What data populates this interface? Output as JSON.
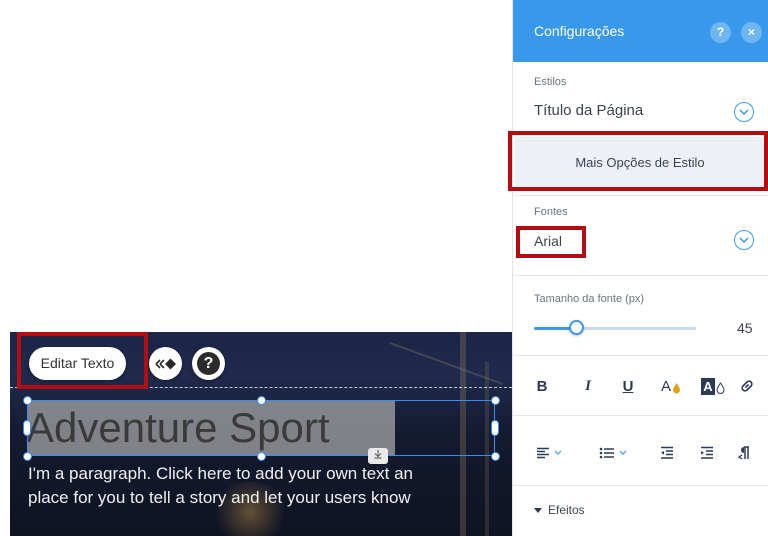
{
  "canvas": {
    "edit_button_label": "Editar Texto",
    "heading_text": "Adventure Sport",
    "paragraph_line1": "I'm a paragraph. Click here to add your own text an",
    "paragraph_line2": "place for you to tell a story and let your users know"
  },
  "panel": {
    "title": "Configurações",
    "help_label": "?",
    "close_label": "×",
    "styles_label": "Estilos",
    "styles_value": "Título da Página",
    "more_style_options": "Mais Opções de Estilo",
    "fonts_label": "Fontes",
    "font_value": "Arial",
    "font_size_label": "Tamanho da fonte (px)",
    "font_size_value": "45",
    "font_size_fraction": 0.26,
    "effects_label": "Efeitos"
  },
  "format_toolbar": {
    "bold": "B",
    "italic": "I",
    "underline": "U",
    "text_color_letter": "A",
    "highlight_letter": "A"
  },
  "icons": [
    "animation-icon",
    "help-icon",
    "chevron-down-icon",
    "link-icon",
    "align-left-icon",
    "bullet-list-icon",
    "decrease-indent-icon",
    "increase-indent-icon",
    "text-direction-icon"
  ],
  "colors": {
    "accent": "#3899ec",
    "highlight_frame": "#b40c12"
  }
}
